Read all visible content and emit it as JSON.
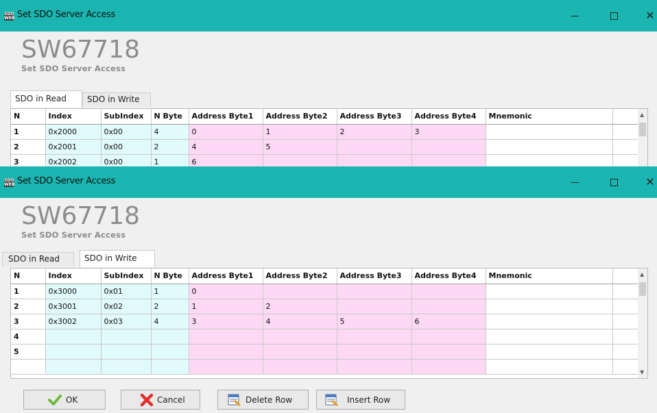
{
  "window1": {
    "title": "Set SDO Server Access",
    "app_icon_text": "SDO WEB",
    "brand_code": "SW67718",
    "brand_subtitle": "Set SDO Server Access",
    "tabs": [
      {
        "label": "SDO in Read",
        "active": true
      },
      {
        "label": "SDO in Write",
        "active": false
      }
    ],
    "columns": [
      "N",
      "Index",
      "SubIndex",
      "N Byte",
      "Address Byte1",
      "Address Byte2",
      "Address Byte3",
      "Address Byte4",
      "Mnemonic"
    ],
    "rows": [
      [
        "1",
        "0x2000",
        "0x00",
        "4",
        "0",
        "1",
        "2",
        "3",
        ""
      ],
      [
        "2",
        "0x2001",
        "0x00",
        "2",
        "4",
        "5",
        "",
        "",
        ""
      ],
      [
        "3",
        "0x2002",
        "0x00",
        "1",
        "6",
        "",
        "",
        "",
        ""
      ]
    ]
  },
  "window2": {
    "title": "Set SDO Server Access",
    "app_icon_text": "SDO WEB",
    "brand_code": "SW67718",
    "brand_subtitle": "Set SDO Server Access",
    "tabs": [
      {
        "label": "SDO in Read",
        "active": false
      },
      {
        "label": "SDO in Write",
        "active": true
      }
    ],
    "columns": [
      "N",
      "Index",
      "SubIndex",
      "N Byte",
      "Address Byte1",
      "Address Byte2",
      "Address Byte3",
      "Address Byte4",
      "Mnemonic"
    ],
    "rows": [
      [
        "1",
        "0x3000",
        "0x01",
        "1",
        "0",
        "",
        "",
        "",
        ""
      ],
      [
        "2",
        "0x3001",
        "0x02",
        "2",
        "1",
        "2",
        "",
        "",
        ""
      ],
      [
        "3",
        "0x3002",
        "0x03",
        "4",
        "3",
        "4",
        "5",
        "6",
        ""
      ],
      [
        "4",
        "",
        "",
        "",
        "",
        "",
        "",
        "",
        ""
      ],
      [
        "5",
        "",
        "",
        "",
        "",
        "",
        "",
        "",
        ""
      ],
      [
        "",
        "",
        "",
        "",
        "",
        "",
        "",
        "",
        ""
      ]
    ]
  },
  "buttons": {
    "ok": "OK",
    "cancel": "Cancel",
    "delete_row": "Delete Row",
    "insert_row": "Insert Row"
  },
  "colors": {
    "titlebar": "#1ab5b0",
    "cyan_cells": "#e1fafc",
    "pink_cells": "#fdd9f5"
  }
}
